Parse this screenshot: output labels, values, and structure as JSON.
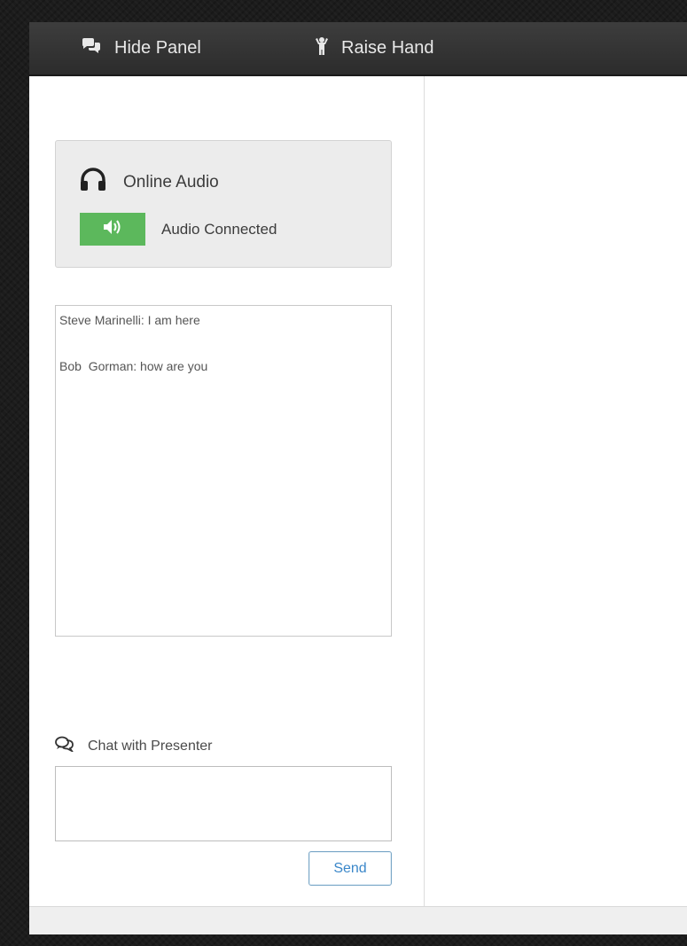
{
  "toolbar": {
    "hide_panel_label": "Hide Panel",
    "hide_panel_icon": "chat-bubbles-icon",
    "raise_hand_label": "Raise Hand",
    "raise_hand_icon": "raised-hand-icon"
  },
  "audio": {
    "title": "Online Audio",
    "title_icon": "headphones-icon",
    "status_text": "Audio Connected",
    "status_icon": "speaker-icon",
    "status_color": "#5cb85c"
  },
  "chat_log": {
    "messages": [
      "Steve Marinelli: I am here",
      "Bob  Gorman: how are you"
    ]
  },
  "chat_compose": {
    "label": "Chat with Presenter",
    "label_icon": "chat-icon",
    "value": "",
    "send_label": "Send"
  },
  "colors": {
    "toolbar_bg": "#333333",
    "accent_green": "#5cb85c",
    "send_text": "#3a87c9"
  }
}
